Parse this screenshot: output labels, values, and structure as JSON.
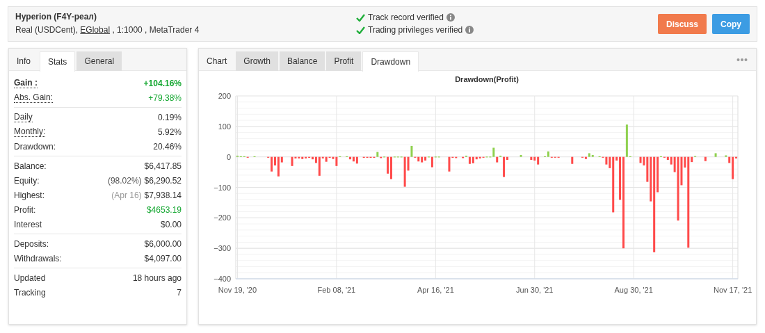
{
  "header": {
    "title": "Hyperion (F4Y-реал)",
    "subtitle_before": "Real (USDCent), ",
    "broker_link": "EGlobal",
    "subtitle_after": " , 1:1000 , MetaTrader 4",
    "verifications": [
      {
        "label": "Track record verified"
      },
      {
        "label": "Trading privileges verified"
      }
    ],
    "buttons": [
      {
        "label": "Discuss",
        "kind": "discuss"
      },
      {
        "label": "Copy",
        "kind": "copy"
      }
    ]
  },
  "stats_panel": {
    "tabs": [
      {
        "label": "Info",
        "selected": false
      },
      {
        "label": "Stats",
        "selected": true
      },
      {
        "label": "General",
        "selected": false
      }
    ],
    "groups": [
      {
        "rows": [
          {
            "label": "Gain :",
            "value": "+104.16%",
            "hint": true,
            "bold": true,
            "positive": true
          },
          {
            "label": "Abs. Gain:",
            "value": "+79.38%",
            "hint": true,
            "bold": false,
            "positive": true
          }
        ]
      },
      {
        "rows": [
          {
            "label": "Daily",
            "value": "0.19%",
            "hint": true,
            "bold": false,
            "positive": false
          },
          {
            "label": "Monthly:",
            "value": "5.92%",
            "hint": true,
            "bold": false,
            "positive": false
          },
          {
            "label": "Drawdown:",
            "value": "20.46%",
            "hint": false,
            "bold": false,
            "positive": false
          }
        ]
      },
      {
        "rows": [
          {
            "label": "Balance:",
            "value": "$6,417.85",
            "hint": false,
            "bold": false,
            "positive": false
          },
          {
            "label": "Equity:",
            "note": "(98.02%)",
            "value": "$6,290.52",
            "hint": false,
            "bold": false,
            "positive": false
          },
          {
            "label": "Highest:",
            "note": "(Apr 16)",
            "value": "$7,938.14",
            "hint": false,
            "bold": false,
            "positive": false
          },
          {
            "label": "Profit:",
            "value": "$4653.19",
            "hint": false,
            "bold": false,
            "positive": true
          },
          {
            "label": "Interest",
            "value": "$0.00",
            "hint": false,
            "bold": false,
            "positive": false
          }
        ]
      },
      {
        "rows": [
          {
            "label": "Deposits:",
            "value": "$6,000.00",
            "hint": false,
            "bold": false,
            "positive": false
          },
          {
            "label": "Withdrawals:",
            "value": "$4,097.00",
            "hint": false,
            "bold": false,
            "positive": false
          }
        ]
      },
      {
        "rows": [
          {
            "label": "Updated",
            "value": "18 hours ago",
            "hint": false,
            "bold": false,
            "positive": false
          },
          {
            "label": "Tracking",
            "value": "7",
            "hint": false,
            "bold": false,
            "positive": false
          }
        ]
      }
    ]
  },
  "chart_panel": {
    "tabs": [
      {
        "label": "Chart",
        "selected": false
      },
      {
        "label": "Growth",
        "selected": false
      },
      {
        "label": "Balance",
        "selected": false
      },
      {
        "label": "Profit",
        "selected": false
      },
      {
        "label": "Drawdown",
        "selected": true
      }
    ],
    "chart_data": {
      "type": "bar",
      "title": "Drawdown(Profit)",
      "grid": true,
      "stacked": true,
      "ylim": [
        -400,
        200
      ],
      "yticks": [
        -400,
        -300,
        -200,
        -100,
        0,
        100,
        200
      ],
      "categories": [
        "Nov 19, '20",
        null,
        null,
        null,
        null,
        null,
        null,
        null,
        null,
        null,
        null,
        null,
        null,
        null,
        null,
        null,
        null,
        null,
        null,
        null,
        null,
        null,
        null,
        null,
        null,
        null,
        null,
        null,
        null,
        "Feb 08, '21",
        null,
        null,
        null,
        null,
        null,
        null,
        null,
        null,
        null,
        null,
        null,
        null,
        null,
        null,
        null,
        null,
        null,
        null,
        null,
        null,
        null,
        null,
        null,
        null,
        null,
        null,
        null,
        null,
        "Apr 16, '21",
        null,
        null,
        null,
        null,
        null,
        null,
        null,
        null,
        null,
        null,
        null,
        null,
        null,
        null,
        null,
        null,
        null,
        null,
        null,
        null,
        null,
        null,
        null,
        null,
        null,
        null,
        null,
        null,
        "Jun 30, '21",
        null,
        null,
        null,
        null,
        null,
        null,
        null,
        null,
        null,
        null,
        null,
        null,
        null,
        null,
        null,
        null,
        null,
        null,
        null,
        null,
        null,
        null,
        null,
        null,
        null,
        null,
        null,
        null,
        "Aug 30, '21",
        null,
        null,
        null,
        null,
        null,
        null,
        null,
        null,
        null,
        null,
        null,
        null,
        null,
        null,
        null,
        null,
        null,
        null,
        null,
        null,
        null,
        null,
        null,
        null,
        null,
        null,
        null,
        null,
        "Nov 17, '21",
        null
      ],
      "series": [
        {
          "color": "#ff4a4a",
          "values": [
            null,
            null,
            null,
            -2,
            null,
            null,
            null,
            null,
            null,
            -2,
            -48,
            -28,
            -64,
            -18,
            null,
            null,
            -30,
            -5,
            -5,
            -7,
            -5,
            -3,
            -8,
            -20,
            -62,
            -5,
            -16,
            -3,
            -7,
            -30,
            null,
            null,
            null,
            -8,
            -15,
            -22,
            null,
            -3,
            -3,
            -3,
            -3,
            null,
            -4,
            null,
            -55,
            -73,
            null,
            null,
            null,
            -98,
            -45,
            null,
            -2,
            -15,
            -18,
            -12,
            null,
            -34,
            null,
            null,
            null,
            null,
            -48,
            -3,
            -4,
            null,
            -4,
            null,
            -23,
            -21,
            -8,
            -5,
            -2,
            null,
            null,
            null,
            -18,
            null,
            -66,
            -10,
            null,
            null,
            null,
            null,
            null,
            null,
            -10,
            -12,
            -25,
            null,
            null,
            null,
            -2,
            -2,
            -2,
            null,
            null,
            null,
            -23,
            null,
            null,
            -2,
            -7,
            null,
            null,
            null,
            null,
            -2,
            -25,
            -37,
            -182,
            -12,
            -141,
            -300,
            null,
            null,
            null,
            null,
            -20,
            -28,
            -82,
            -146,
            -313,
            -116,
            null,
            -2,
            -10,
            -25,
            -50,
            -209,
            -93,
            -35,
            -298,
            -17,
            null,
            null,
            null,
            -14,
            null,
            null,
            null,
            null,
            null,
            null,
            -20,
            -73,
            -5
          ]
        },
        {
          "color": "#8fd14f",
          "values": [
            4,
            2,
            2,
            null,
            null,
            2,
            null,
            null,
            null,
            null,
            null,
            null,
            null,
            null,
            null,
            null,
            null,
            null,
            null,
            null,
            null,
            null,
            null,
            null,
            null,
            null,
            null,
            null,
            null,
            null,
            2,
            null,
            2,
            null,
            null,
            null,
            null,
            null,
            null,
            null,
            null,
            16,
            null,
            1,
            null,
            null,
            1,
            1,
            1,
            null,
            null,
            36,
            null,
            null,
            null,
            null,
            1,
            null,
            1,
            1,
            null,
            null,
            null,
            null,
            null,
            null,
            null,
            4,
            null,
            null,
            null,
            null,
            null,
            1,
            1,
            30,
            null,
            4,
            null,
            null,
            null,
            null,
            null,
            6,
            null,
            null,
            null,
            null,
            null,
            null,
            2,
            18,
            null,
            null,
            null,
            null,
            null,
            null,
            null,
            null,
            null,
            null,
            null,
            12,
            6,
            null,
            2,
            null,
            null,
            null,
            null,
            null,
            null,
            null,
            106,
            2,
            null,
            null,
            null,
            null,
            null,
            null,
            null,
            null,
            2,
            null,
            null,
            null,
            null,
            null,
            null,
            null,
            null,
            null,
            3,
            null,
            null,
            null,
            null,
            null,
            12,
            null,
            null,
            5,
            null,
            null,
            null
          ]
        }
      ]
    }
  }
}
